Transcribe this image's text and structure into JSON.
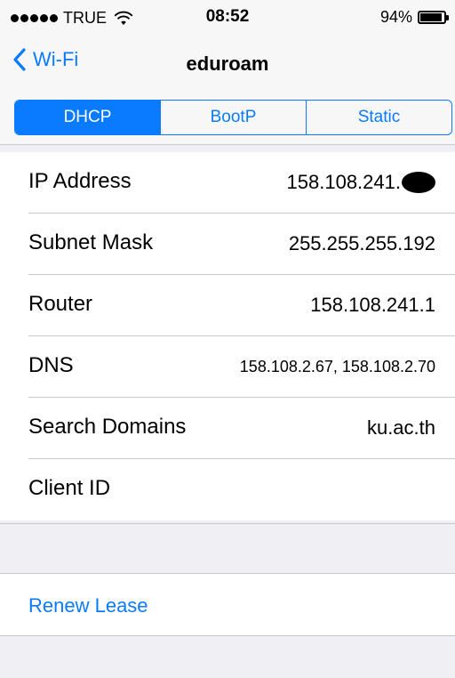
{
  "status_bar": {
    "carrier": "TRUE",
    "time": "08:52",
    "battery_percent": "94%",
    "battery_level": 0.94,
    "icons": [
      "signal-dots-icon",
      "wifi-icon",
      "battery-icon"
    ]
  },
  "nav": {
    "back_label": "Wi-Fi",
    "title": "eduroam"
  },
  "segments": [
    {
      "label": "DHCP",
      "selected": true
    },
    {
      "label": "BootP",
      "selected": false
    },
    {
      "label": "Static",
      "selected": false
    }
  ],
  "details": {
    "ip_address": {
      "label": "IP Address",
      "value": "158.108.241."
    },
    "subnet_mask": {
      "label": "Subnet Mask",
      "value": "255.255.255.192"
    },
    "router": {
      "label": "Router",
      "value": "158.108.241.1"
    },
    "dns": {
      "label": "DNS",
      "value": "158.108.2.67, 158.108.2.70"
    },
    "search_domains": {
      "label": "Search Domains",
      "value": "ku.ac.th"
    },
    "client_id": {
      "label": "Client ID",
      "value": ""
    }
  },
  "actions": {
    "renew_lease": "Renew Lease"
  },
  "colors": {
    "accent": "#0a7bff",
    "background": "#efeff4",
    "separator": "#c8c7cc"
  }
}
